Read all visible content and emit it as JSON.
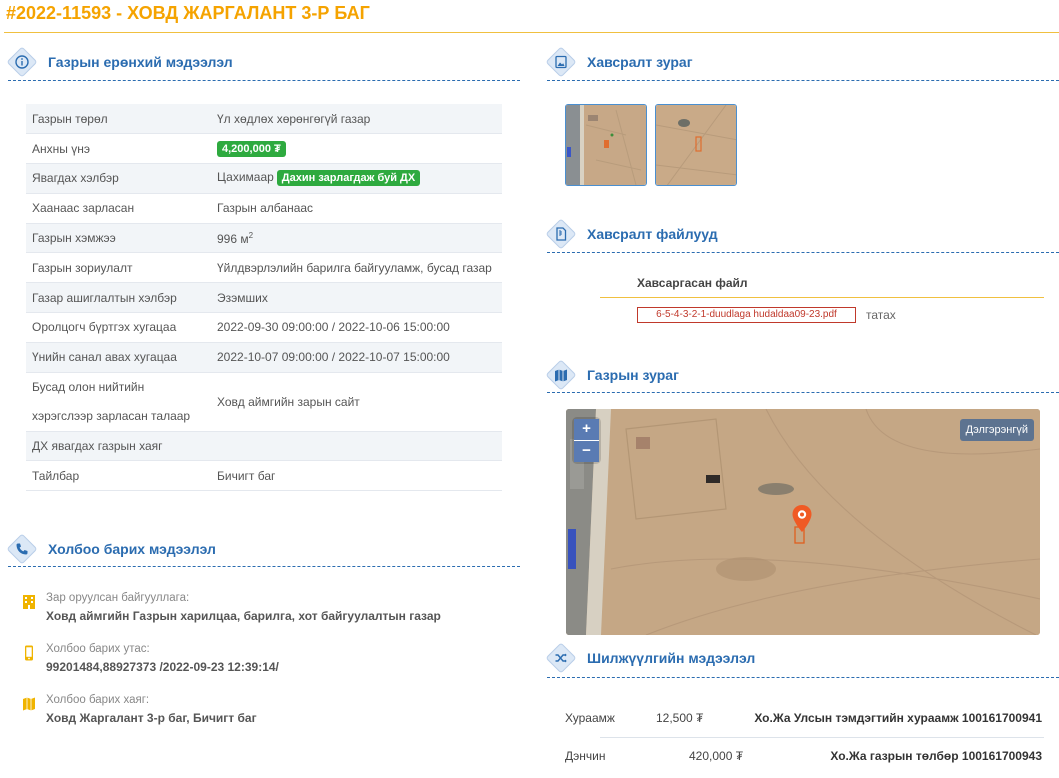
{
  "header": {
    "code": "#2022-11593",
    "separator": " - ",
    "name": "ХОВД ЖАРГАЛАНТ 3-Р БАГ"
  },
  "sections": {
    "general": "Газрын ерөнхий мэдээлэл",
    "contact": "Холбоо барих мэдээлэл",
    "photos": "Хавсралт зураг",
    "files": "Хавсралт файлууд",
    "map": "Газрын зураг",
    "transfer": "Шилжүүлгийн мэдээлэл"
  },
  "general_info": [
    {
      "label": "Газрын төрөл",
      "value": "Үл хөдлөх хөрөнгөгүй газар"
    },
    {
      "label": "Анхны үнэ",
      "badge": "4,200,000 ₮"
    },
    {
      "label": "Явагдах хэлбэр",
      "value": "Цахимаар",
      "badge": "Дахин зарлагдаж буй ДХ"
    },
    {
      "label": "Хаанаас зарласан",
      "value": "Газрын албанаас"
    },
    {
      "label": "Газрын хэмжээ",
      "value": "996 м",
      "unit_sup": "2"
    },
    {
      "label": "Газрын зориулалт",
      "value": "Үйлдвэрлэлийн барилга байгууламж, бусад газар"
    },
    {
      "label": "Газар ашиглалтын хэлбэр",
      "value": "Эзэмших"
    },
    {
      "label": "Оролцогч бүртгэх хугацаа",
      "value": "2022-09-30 09:00:00 / 2022-10-06 15:00:00"
    },
    {
      "label": "Үнийн санал авах хугацаа",
      "value": "2022-10-07 09:00:00 / 2022-10-07 15:00:00"
    },
    {
      "label": "Бусад олон нийтийн хэрэгслээр зарласан талаар",
      "value": "Ховд аймгийн зарын сайт"
    },
    {
      "label": "ДХ явагдах газрын хаяг",
      "value": ""
    },
    {
      "label": "Тайлбар",
      "value": "Бичигт баг"
    }
  ],
  "contact": [
    {
      "icon": "building-icon",
      "label": "Зар оруулсан байгууллага:",
      "value": "Ховд аймгийн Газрын харилцаа, барилга, хот байгуулалтын газар"
    },
    {
      "icon": "phone-icon",
      "label": "Холбоо барих утас:",
      "value": "99201484,88927373 /2022-09-23 12:39:14/"
    },
    {
      "icon": "map-icon",
      "label": "Холбоо барих хаяг:",
      "value": "Ховд Жаргалант 3-р баг, Бичигт баг"
    }
  ],
  "files": {
    "column_header": "Хавсаргасан файл",
    "items": [
      {
        "name": "6-5-4-3-2-1-duudlaga hudaldaa09-23.pdf",
        "action": "татах"
      }
    ]
  },
  "map": {
    "zoom_in": "+",
    "zoom_out": "−",
    "expand_label": "Дэлгэрэнгүй"
  },
  "transfer": [
    {
      "type": "Хураамж",
      "amount": "12,500 ₮",
      "account": "Хо.Жа Улсын тэмдэгтийн хураамж 100161700941"
    },
    {
      "type": "Дэнчин",
      "amount": "420,000 ₮",
      "account": "Хо.Жа газрын төлбөр 100161700943"
    }
  ],
  "colors": {
    "accent": "#2b6cb0",
    "title": "#f5a300",
    "badge_green": "#2eaa3f",
    "file_red": "#c0392b"
  }
}
